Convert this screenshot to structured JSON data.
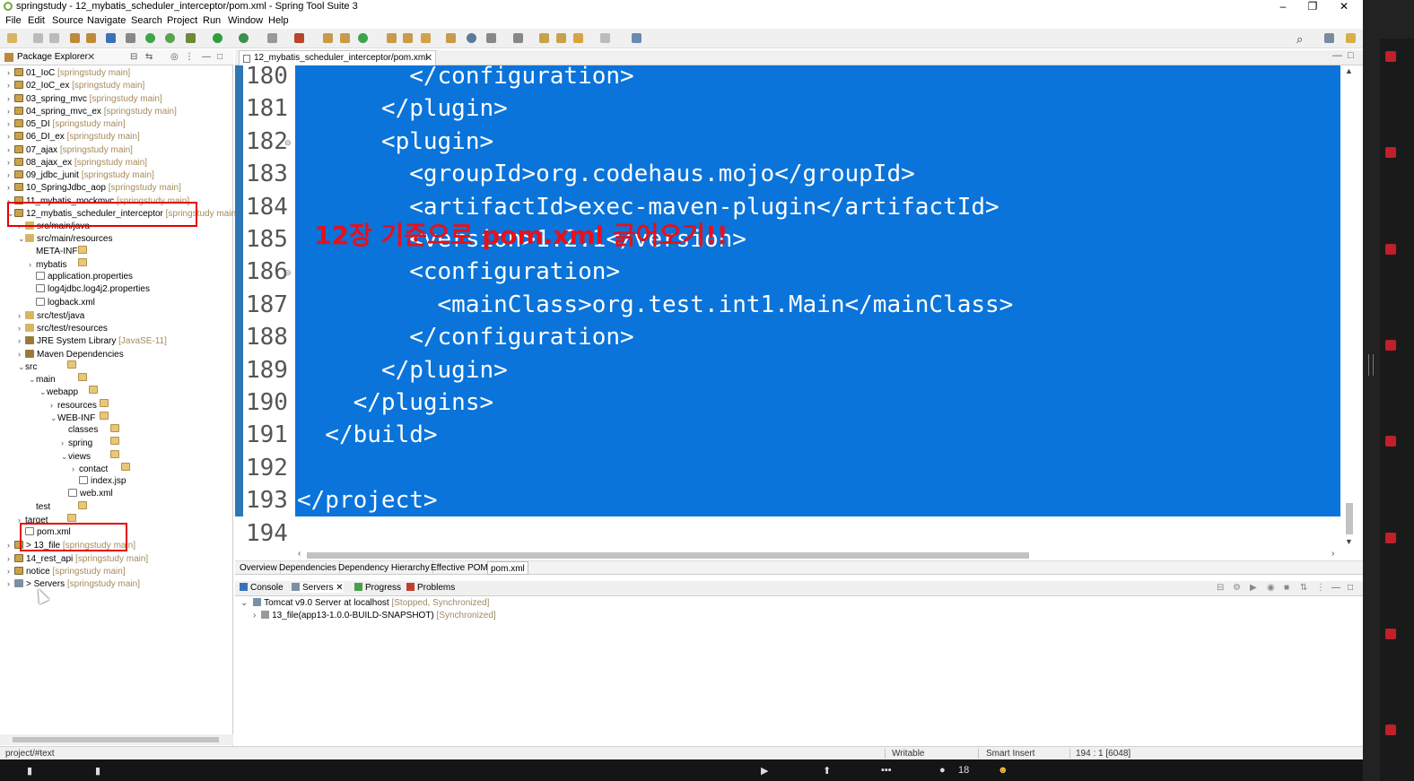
{
  "window": {
    "title": "springstudy - 12_mybatis_scheduler_interceptor/pom.xml - Spring Tool Suite 3",
    "controls": [
      "✕"
    ]
  },
  "menu": [
    "File",
    "Edit",
    "Source",
    "Navigate",
    "Search",
    "Project",
    "Run",
    "Window",
    "Help"
  ],
  "package_explorer": {
    "title": "Package Explorer",
    "items": [
      {
        "label": "01_IoC",
        "deco": "[springstudy main]"
      },
      {
        "label": "02_IoC_ex",
        "deco": "[springstudy main]"
      },
      {
        "label": "03_spring_mvc",
        "deco": "[springstudy main]"
      },
      {
        "label": "04_spring_mvc_ex",
        "deco": "[springstudy main]"
      },
      {
        "label": "05_DI",
        "deco": "[springstudy main]"
      },
      {
        "label": "06_DI_ex",
        "deco": "[springstudy main]"
      },
      {
        "label": "07_ajax",
        "deco": "[springstudy main]"
      },
      {
        "label": "08_ajax_ex",
        "deco": "[springstudy main]"
      },
      {
        "label": "09_jdbc_junit",
        "deco": "[springstudy main]"
      },
      {
        "label": "10_SpringJdbc_aop",
        "deco": "[springstudy main]"
      },
      {
        "label": "11_mybatis_mockmvc",
        "deco": "[springstudy main]"
      },
      {
        "label": "12_mybatis_scheduler_interceptor",
        "deco": "[springstudy main]"
      },
      {
        "label": "src/main/java",
        "deco": ""
      },
      {
        "label": "src/main/resources",
        "deco": ""
      },
      {
        "label": "META-INF",
        "deco": ""
      },
      {
        "label": "mybatis",
        "deco": ""
      },
      {
        "label": "application.properties",
        "deco": ""
      },
      {
        "label": "log4jdbc.log4j2.properties",
        "deco": ""
      },
      {
        "label": "logback.xml",
        "deco": ""
      },
      {
        "label": "src/test/java",
        "deco": ""
      },
      {
        "label": "src/test/resources",
        "deco": ""
      },
      {
        "label": "JRE System Library",
        "deco": "[JavaSE-11]"
      },
      {
        "label": "Maven Dependencies",
        "deco": ""
      },
      {
        "label": "src",
        "deco": ""
      },
      {
        "label": "main",
        "deco": ""
      },
      {
        "label": "webapp",
        "deco": ""
      },
      {
        "label": "resources",
        "deco": ""
      },
      {
        "label": "WEB-INF",
        "deco": ""
      },
      {
        "label": "classes",
        "deco": ""
      },
      {
        "label": "spring",
        "deco": ""
      },
      {
        "label": "views",
        "deco": ""
      },
      {
        "label": "contact",
        "deco": ""
      },
      {
        "label": "index.jsp",
        "deco": ""
      },
      {
        "label": "web.xml",
        "deco": ""
      },
      {
        "label": "test",
        "deco": ""
      },
      {
        "label": "target",
        "deco": ""
      },
      {
        "label": "pom.xml",
        "deco": ""
      },
      {
        "label": "> 13_file",
        "deco": "[springstudy main]"
      },
      {
        "label": "14_rest_api",
        "deco": "[springstudy main]"
      },
      {
        "label": "notice",
        "deco": "[springstudy main]"
      },
      {
        "label": "> Servers",
        "deco": "[springstudy main]"
      }
    ]
  },
  "editor": {
    "tab_label": "12_mybatis_scheduler_interceptor/pom.xml",
    "lines": [
      {
        "n": "180",
        "code": "        </configuration>"
      },
      {
        "n": "181",
        "code": "      </plugin>"
      },
      {
        "n": "182",
        "code": "      <plugin>"
      },
      {
        "n": "183",
        "code": "        <groupId>org.codehaus.mojo</groupId>"
      },
      {
        "n": "184",
        "code": "        <artifactId>exec-maven-plugin</artifactId>"
      },
      {
        "n": "185",
        "code": "        <version>1.2.1</version>"
      },
      {
        "n": "186",
        "code": "        <configuration>"
      },
      {
        "n": "187",
        "code": "          <mainClass>org.test.int1.Main</mainClass>"
      },
      {
        "n": "188",
        "code": "        </configuration>"
      },
      {
        "n": "189",
        "code": "      </plugin>"
      },
      {
        "n": "190",
        "code": "    </plugins>"
      },
      {
        "n": "191",
        "code": "  </build>"
      },
      {
        "n": "192",
        "code": ""
      },
      {
        "n": "193",
        "code": "</project>"
      },
      {
        "n": "194",
        "code": ""
      }
    ],
    "overlay_text": "12장 기준으로 pom.xml 긁어오기!!",
    "pom_tabs": [
      "Overview",
      "Dependencies",
      "Dependency Hierarchy",
      "Effective POM",
      "pom.xml"
    ]
  },
  "bottom_panel": {
    "tabs": [
      "Console",
      "Servers",
      "Progress",
      "Problems"
    ],
    "server": {
      "label": "Tomcat v9.0 Server at localhost",
      "deco": "[Stopped, Synchronized]"
    },
    "module": {
      "label": "13_file(app13-1.0.0-BUILD-SNAPSHOT)",
      "deco": "[Synchronized]"
    }
  },
  "status": {
    "left": "project/#text",
    "writable": "Writable",
    "insert": "Smart Insert",
    "position": "194 : 1 [6048]"
  },
  "taskbar": {
    "count": "18"
  },
  "colors": {
    "selection": "#0a74da",
    "annotation": "#e8101a"
  }
}
